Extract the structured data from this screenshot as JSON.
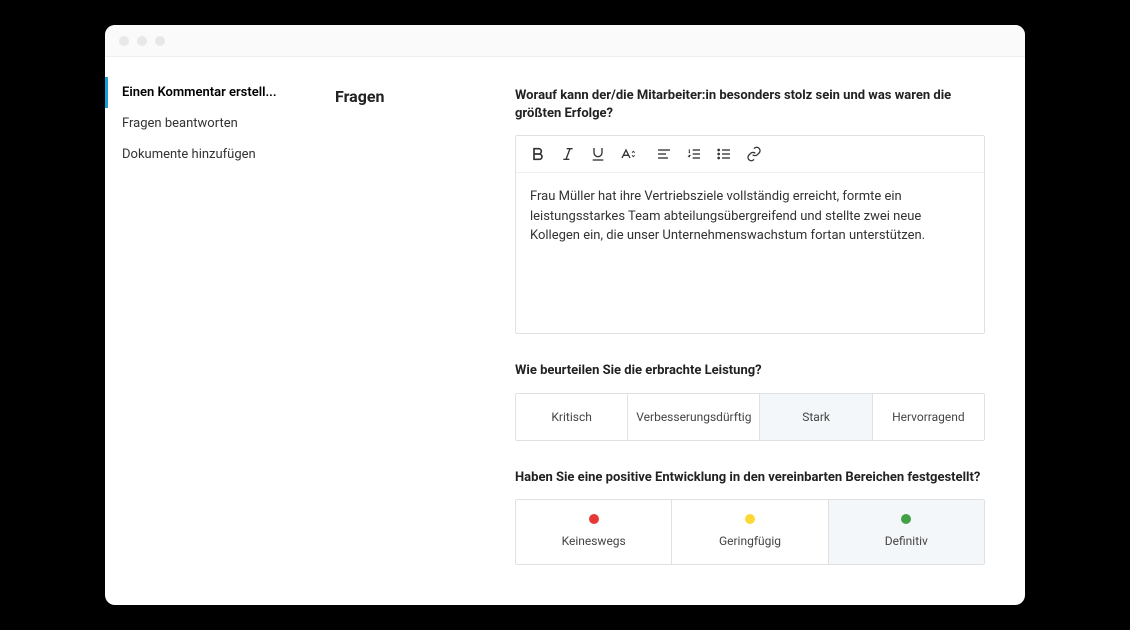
{
  "sidebar": {
    "items": [
      {
        "label": "Einen Kommentar erstell...",
        "active": true
      },
      {
        "label": "Fragen beantworten",
        "active": false
      },
      {
        "label": "Dokumente hinzufügen",
        "active": false
      }
    ]
  },
  "main": {
    "section_title": "Fragen",
    "question1": {
      "label": "Worauf kann der/die Mitarbeiter:in besonders stolz sein und was waren die größten Erfolge?",
      "value": "Frau Müller hat ihre Vertriebsziele vollständig erreicht, formte ein leistungsstarkes Team abteilungsübergreifend und stellte zwei neue Kollegen ein, die unser Unternehmenswachstum fortan unterstützen."
    },
    "question2": {
      "label": "Wie beurteilen Sie die erbrachte Leistung?",
      "options": [
        "Kritisch",
        "Verbesserungsdürftig",
        "Stark",
        "Hervorragend"
      ],
      "selected_index": 2
    },
    "question3": {
      "label": "Haben Sie eine positive Entwicklung in den vereinbarten Bereichen festgestellt?",
      "options": [
        {
          "label": "Keineswegs",
          "color": "#e53935"
        },
        {
          "label": "Geringfügig",
          "color": "#fdd835"
        },
        {
          "label": "Definitiv",
          "color": "#43a047"
        }
      ],
      "selected_index": 2
    }
  }
}
